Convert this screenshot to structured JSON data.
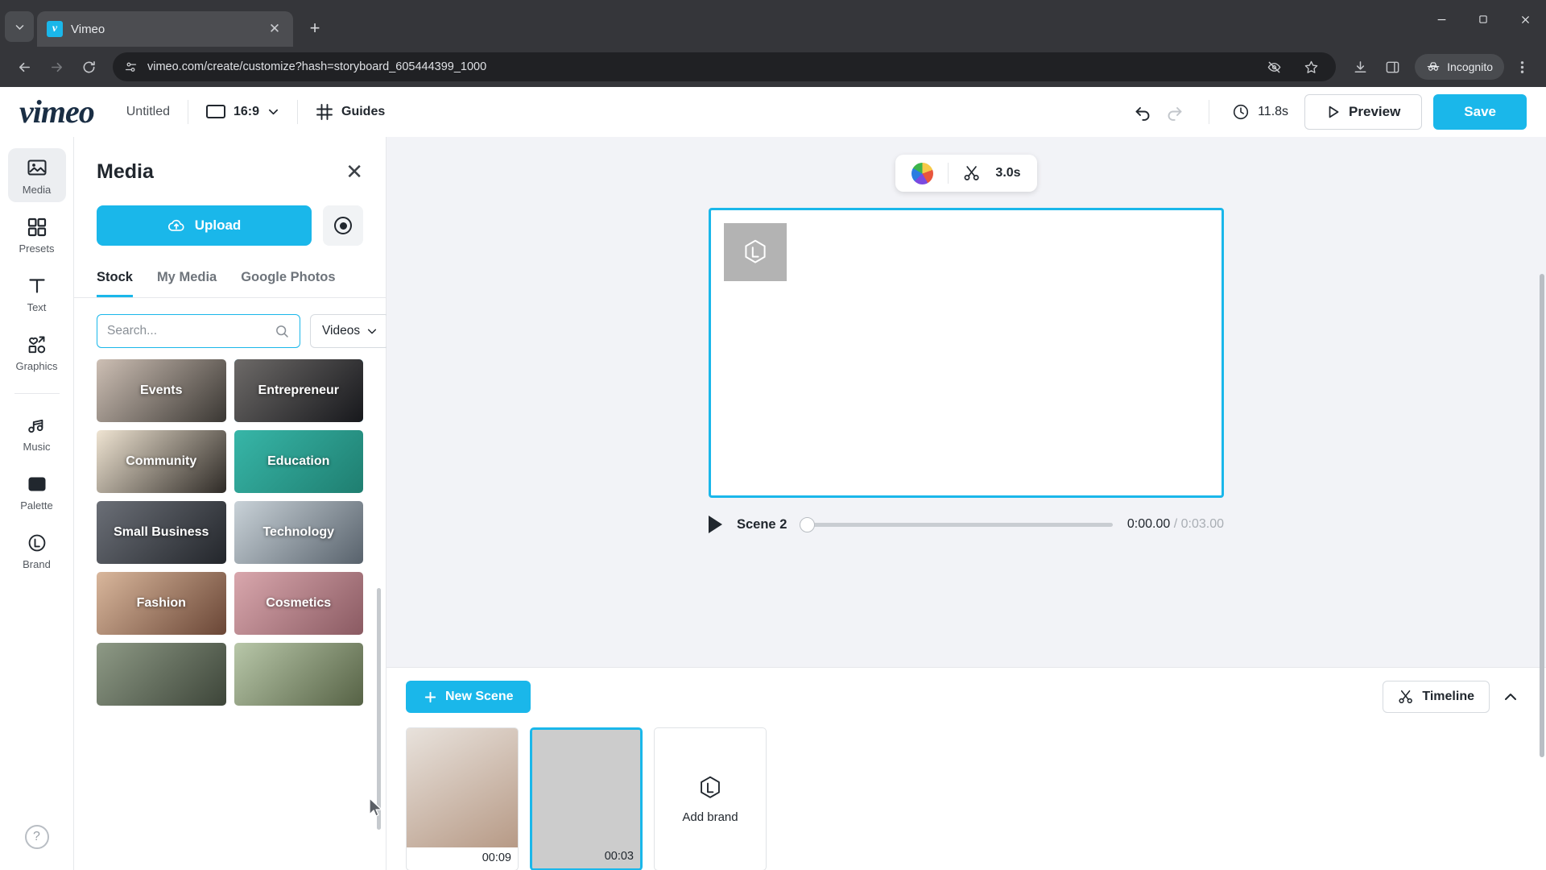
{
  "browser": {
    "tab": {
      "title": "Vimeo",
      "favicon_letter": "v",
      "close_icon": "close-icon"
    },
    "new_tab_label": "+",
    "url": "vimeo.com/create/customize?hash=storyboard_605444399_1000",
    "incognito_label": "Incognito",
    "icons": {
      "tab_list": "chevron-down-icon",
      "back": "back-arrow-icon",
      "forward": "forward-arrow-icon",
      "reload": "reload-icon",
      "site_info": "page-settings-icon",
      "hide_tracking": "eye-slash-icon",
      "bookmark": "star-icon",
      "download": "download-icon",
      "side_panel": "side-panel-icon",
      "menu": "kebab-menu-icon",
      "minimize": "minimize-icon",
      "maximize": "maximize-icon",
      "close_window": "close-window-icon"
    }
  },
  "appbar": {
    "logo": "vimeo",
    "project_title": "Untitled",
    "aspect_ratio": "16:9",
    "guides_label": "Guides",
    "duration": "11.8s",
    "preview_label": "Preview",
    "save_label": "Save"
  },
  "sidebar": {
    "items": [
      {
        "label": "Media",
        "icon": "image-icon",
        "active": true
      },
      {
        "label": "Presets",
        "icon": "grid-icon",
        "active": false
      },
      {
        "label": "Text",
        "icon": "text-t-icon",
        "active": false
      },
      {
        "label": "Graphics",
        "icon": "shapes-icon",
        "active": false
      },
      {
        "label": "Music",
        "icon": "music-note-icon",
        "active": false
      },
      {
        "label": "Palette",
        "icon": "palette-icon",
        "active": false
      },
      {
        "label": "Brand",
        "icon": "brand-hexagon-icon",
        "active": false
      }
    ],
    "help_icon": "question-mark-icon"
  },
  "media_panel": {
    "title": "Media",
    "close_icon": "close-icon",
    "upload_label": "Upload",
    "upload_icon": "cloud-upload-icon",
    "record_icon": "record-icon",
    "tabs": [
      {
        "label": "Stock",
        "active": true
      },
      {
        "label": "My Media",
        "active": false
      },
      {
        "label": "Google Photos",
        "active": false
      }
    ],
    "search": {
      "value": "",
      "placeholder": "Search...",
      "icon": "search-icon"
    },
    "filter": {
      "value": "Videos",
      "icon": "chevron-down-icon"
    },
    "categories": [
      {
        "label": "Events",
        "selected": false,
        "c1": "#cdbfb4",
        "c2": "#3a3733"
      },
      {
        "label": "Entrepreneur",
        "selected": true,
        "c1": "#6d6a68",
        "c2": "#17181c"
      },
      {
        "label": "Community",
        "selected": false,
        "c1": "#efe4d2",
        "c2": "#2e2a26"
      },
      {
        "label": "Education",
        "selected": false,
        "c1": "#37b6a8",
        "c2": "#1f7e70"
      },
      {
        "label": "Small Business",
        "selected": false,
        "c1": "#6b6f77",
        "c2": "#23262b"
      },
      {
        "label": "Technology",
        "selected": false,
        "c1": "#c9d2d8",
        "c2": "#58626c"
      },
      {
        "label": "Fashion",
        "selected": false,
        "c1": "#d9b79c",
        "c2": "#6a4636"
      },
      {
        "label": "Cosmetics",
        "selected": false,
        "c1": "#d9a7ad",
        "c2": "#8a5a62"
      },
      {
        "label": "",
        "selected": false,
        "c1": "#8e9a86",
        "c2": "#3d4539"
      },
      {
        "label": "",
        "selected": false,
        "c1": "#b8c7a9",
        "c2": "#566245"
      }
    ]
  },
  "stage": {
    "scene_badge": {
      "color_icon": "color-wheel-icon",
      "scissors_icon": "scissors-icon",
      "duration": "3.0s"
    },
    "canvas": {
      "brand_placeholder_icon": "brand-hexagon-icon"
    },
    "playback": {
      "play_icon": "play-icon",
      "scene_name": "Scene 2",
      "current_time": "0:00.00",
      "separator": " / ",
      "total_time": "0:03.00",
      "progress_percent": 0
    }
  },
  "timeline": {
    "new_scene_label": "New Scene",
    "new_scene_icon": "plus-icon",
    "timeline_label": "Timeline",
    "timeline_icon": "scissors-icon",
    "collapse_icon": "chevron-up-icon",
    "scenes": [
      {
        "duration": "00:09",
        "selected": false,
        "c1": "#e8e2dc",
        "c2": "#b79a86",
        "has_media": true
      },
      {
        "duration": "00:03",
        "selected": true,
        "c1": "#cccccc",
        "c2": "#cccccc",
        "has_media": false
      }
    ],
    "add_brand": {
      "label": "Add brand",
      "icon": "brand-hexagon-icon"
    }
  }
}
